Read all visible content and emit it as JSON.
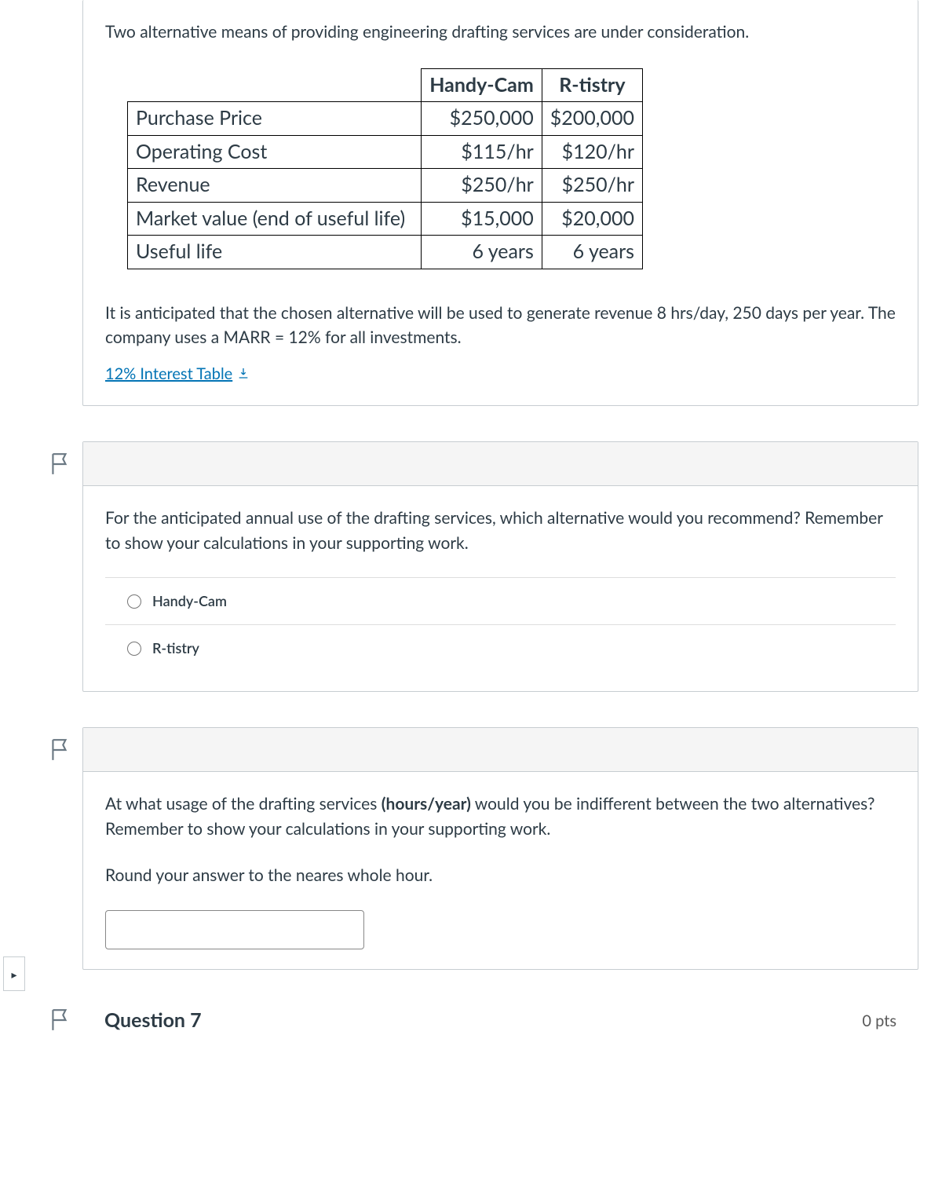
{
  "intro": "Two alternative means of providing engineering drafting services are under consideration.",
  "table": {
    "headers": {
      "col1": "Handy-Cam",
      "col2": "R-tistry"
    },
    "rows": [
      {
        "label": "Purchase Price",
        "c1": "$250,000",
        "c2": "$200,000"
      },
      {
        "label": "Operating Cost",
        "c1": "$115/hr",
        "c2": "$120/hr"
      },
      {
        "label": "Revenue",
        "c1": "$250/hr",
        "c2": "$250/hr"
      },
      {
        "label": "Market value (end of useful life)",
        "c1": "$15,000",
        "c2": "$20,000"
      },
      {
        "label": "Useful life",
        "c1": "6 years",
        "c2": "6 years"
      }
    ]
  },
  "assumption": "It is anticipated that the chosen alternative will be used to generate revenue 8 hrs/day, 250 days per year.  The company uses a MARR = 12% for all investments.",
  "link_label": "12% Interest Table",
  "q_recommend": {
    "text": "For the anticipated annual use of the drafting services, which alternative would you recommend?  Remember to show your calculations in your supporting work.",
    "options": [
      "Handy-Cam",
      "R-tistry"
    ]
  },
  "q_indiff": {
    "text_pre": "At what usage of the drafting services ",
    "text_bold": "(hours/year)",
    "text_post": " would you be indifferent between the two alternatives?  Remember to show your calculations in your supporting work.",
    "round_note": "Round your answer to the neares whole hour."
  },
  "next_question_label": "Question 7",
  "next_question_pts": "0 pts",
  "side_toggle": "▸"
}
